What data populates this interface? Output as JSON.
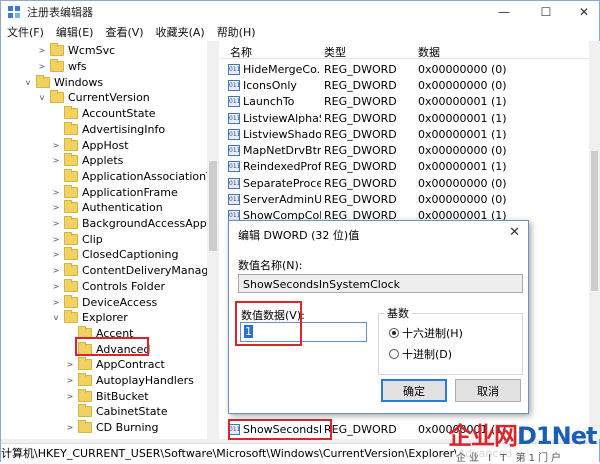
{
  "window": {
    "title": "注册表编辑器",
    "minimize_glyph": "—",
    "maximize_glyph": "☐",
    "close_glyph": "✕",
    "accent": "#2b6fd1"
  },
  "menu": [
    "文件(F)",
    "编辑(E)",
    "查看(V)",
    "收藏夹(A)",
    "帮助(H)"
  ],
  "tree": {
    "items": [
      {
        "label": "WcmSvc",
        "expand": ">"
      },
      {
        "label": "wfs",
        "expand": ">"
      },
      {
        "label": "Windows",
        "expand": "v"
      },
      {
        "label": "CurrentVersion",
        "expand": "v"
      },
      {
        "label": "AccountState",
        "expand": ""
      },
      {
        "label": "AdvertisingInfo",
        "expand": ""
      },
      {
        "label": "AppHost",
        "expand": ">"
      },
      {
        "label": "Applets",
        "expand": ">"
      },
      {
        "label": "ApplicationAssociationToast",
        "expand": ""
      },
      {
        "label": "ApplicationFrame",
        "expand": ">"
      },
      {
        "label": "Authentication",
        "expand": ">"
      },
      {
        "label": "BackgroundAccessApplicati",
        "expand": ">"
      },
      {
        "label": "Clip",
        "expand": ">"
      },
      {
        "label": "ClosedCaptioning",
        "expand": ">"
      },
      {
        "label": "ContentDeliveryManager",
        "expand": ">"
      },
      {
        "label": "Controls Folder",
        "expand": ">"
      },
      {
        "label": "DeviceAccess",
        "expand": ">"
      },
      {
        "label": "Explorer",
        "expand": "v"
      },
      {
        "label": "Accent",
        "expand": ""
      },
      {
        "label": "Advanced",
        "expand": ""
      },
      {
        "label": "AppContract",
        "expand": ">"
      },
      {
        "label": "AutoplayHandlers",
        "expand": ">"
      },
      {
        "label": "BitBucket",
        "expand": ">"
      },
      {
        "label": "CabinetState",
        "expand": ""
      },
      {
        "label": "CD Burning",
        "expand": ">"
      }
    ]
  },
  "list": {
    "headers": {
      "name": "名称",
      "type": "类型",
      "data": "数据"
    },
    "icon_text": "011",
    "rows": [
      {
        "name": "HideMergeCo...",
        "type": "REG_DWORD",
        "data": "0x00000000 (0)"
      },
      {
        "name": "IconsOnly",
        "type": "REG_DWORD",
        "data": "0x00000000 (0)"
      },
      {
        "name": "LaunchTo",
        "type": "REG_DWORD",
        "data": "0x00000001 (1)"
      },
      {
        "name": "ListviewAlphaS...",
        "type": "REG_DWORD",
        "data": "0x00000001 (1)"
      },
      {
        "name": "ListviewShadow",
        "type": "REG_DWORD",
        "data": "0x00000001 (1)"
      },
      {
        "name": "MapNetDrvBtn",
        "type": "REG_DWORD",
        "data": "0x00000000 (0)"
      },
      {
        "name": "ReindexedProf...",
        "type": "REG_DWORD",
        "data": "0x00000001 (1)"
      },
      {
        "name": "SeparateProce...",
        "type": "REG_DWORD",
        "data": "0x00000000 (0)"
      },
      {
        "name": "ServerAdminUI",
        "type": "REG_DWORD",
        "data": "0x00000000 (0)"
      },
      {
        "name": "ShowCompCol...",
        "type": "REG_DWORD",
        "data": "0x00000001 (1)"
      }
    ],
    "bottom_row": {
      "name": "ShowSecondsI...",
      "type": "REG_DWORD",
      "data": "0x00000001 (1)"
    }
  },
  "statusbar": {
    "path": "计算机\\HKEY_CURRENT_USER\\Software\\Microsoft\\Windows\\CurrentVersion\\Explorer\\Advanced"
  },
  "dialog": {
    "title": "编辑 DWORD (32 位)值",
    "close_glyph": "✕",
    "name_label": "数值名称(N):",
    "name_value": "ShowSecondsInSystemClock",
    "data_label": "数值数据(V):",
    "data_value": "1",
    "base_label": "基数",
    "base_options": [
      {
        "label": "十六进制(H)",
        "selected": true
      },
      {
        "label": "十进制(D)",
        "selected": false
      }
    ],
    "ok_label": "确定",
    "cancel_label": "取消"
  },
  "watermark": {
    "brand_a": "企业网",
    "brand_b": "D1Net",
    "tagline": "企业 I T 第1门户"
  },
  "colors": {
    "highlight": "#d9252b",
    "brand_red": "#d9252b",
    "brand_blue": "#1b5fb5"
  }
}
